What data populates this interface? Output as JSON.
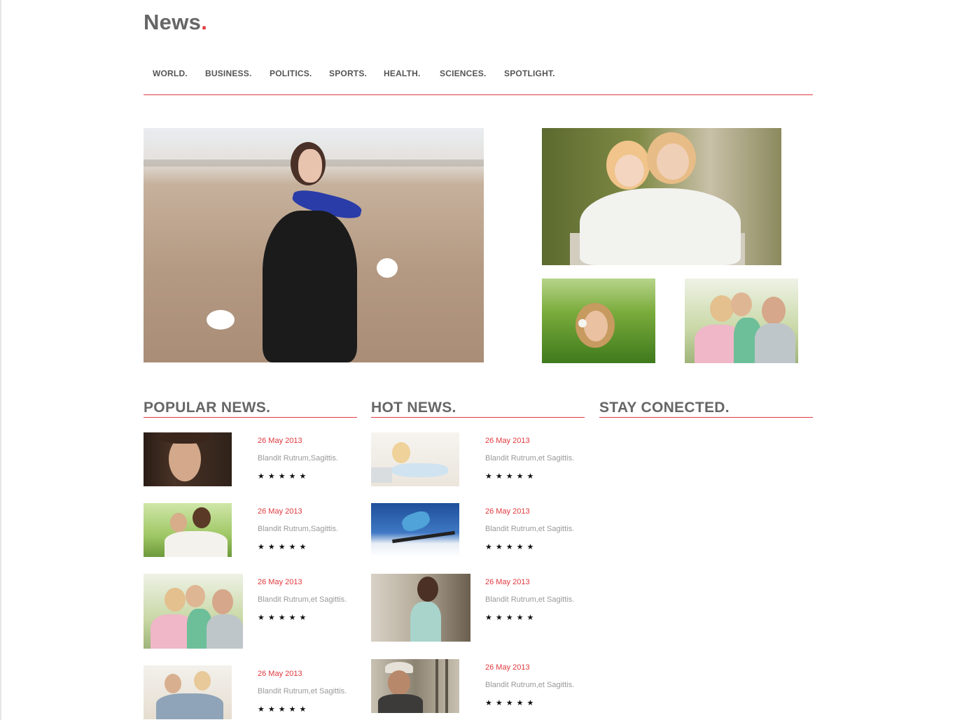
{
  "brand": {
    "name": "News",
    "dot": "."
  },
  "nav": {
    "items": [
      {
        "label": "WORLD."
      },
      {
        "label": "BUSINESS."
      },
      {
        "label": "POLITICS."
      },
      {
        "label": "SPORTS."
      },
      {
        "label": "HEALTH."
      },
      {
        "label": "SCIENCES."
      },
      {
        "label": "SPOTLIGHT."
      }
    ]
  },
  "featured": {
    "images": [
      {
        "icon": "woman-on-beach-photo"
      },
      {
        "icon": "children-hugging-photo"
      },
      {
        "icon": "woman-in-grass-photo"
      },
      {
        "icon": "family-photo"
      }
    ]
  },
  "popular": {
    "title": "POPULAR NEWS.",
    "items": [
      {
        "date": "26 May 2013",
        "text": "Blandit Rutrum,Sagittis.",
        "stars": "★★★★★"
      },
      {
        "date": "26 May 2013",
        "text": "Blandit Rutrum,Sagittis.",
        "stars": "★★★★★"
      },
      {
        "date": "26 May 2013",
        "text": "Blandit Rutrum,et Sagittis.",
        "stars": "★★★★★"
      },
      {
        "date": "26 May 2013",
        "text": "Blandit Rutrum,et Sagittis.",
        "stars": "★★★★★"
      }
    ]
  },
  "hot": {
    "title": "HOT NEWS.",
    "items": [
      {
        "date": "26 May 2013",
        "text": "Blandit Rutrum,et Sagittis.",
        "stars": "★★★★★"
      },
      {
        "date": "26 May 2013",
        "text": "Blandit Rutrum,et Sagittis.",
        "stars": "★★★★★"
      },
      {
        "date": "26 May 2013",
        "text": "Blandit Rutrum,et Sagittis.",
        "stars": "★★★★★"
      },
      {
        "date": "26 May 2013",
        "text": "Blandit Rutrum,et Sagittis.",
        "stars": "★★★★★"
      }
    ]
  },
  "connected": {
    "title": "STAY CONECTED."
  },
  "colors": {
    "accent": "#e0393e",
    "heading": "#666666",
    "muted": "#999999"
  }
}
